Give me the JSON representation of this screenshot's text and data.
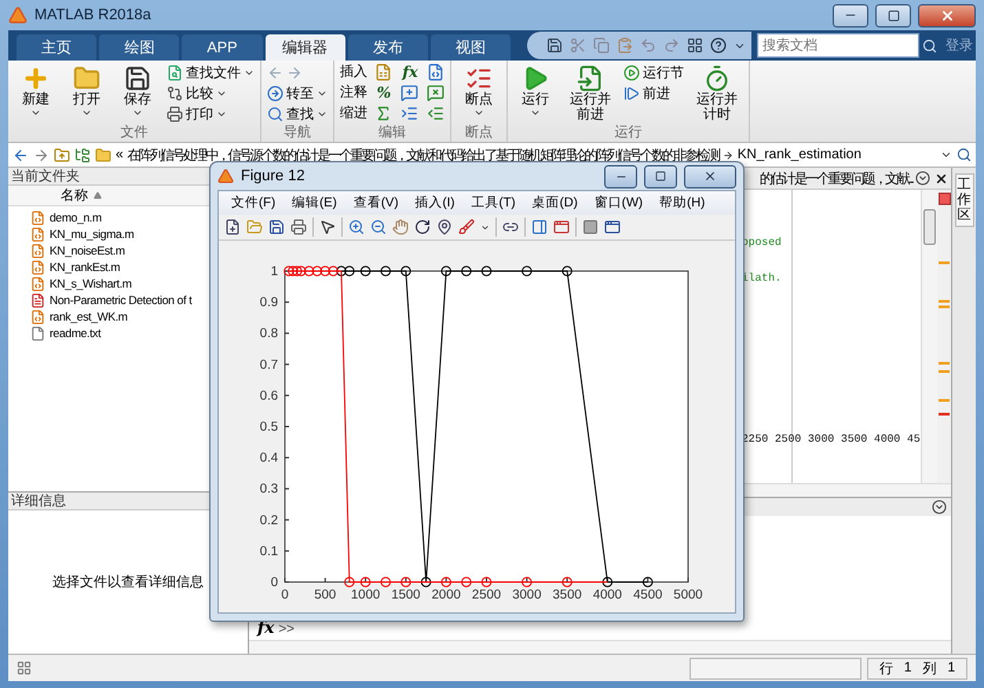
{
  "window": {
    "title": "MATLAB R2018a"
  },
  "ribbon_tabs": [
    {
      "label": "主页",
      "selected": false
    },
    {
      "label": "绘图",
      "selected": false
    },
    {
      "label": "APP",
      "selected": false
    },
    {
      "label": "编辑器",
      "selected": true
    },
    {
      "label": "发布",
      "selected": false
    },
    {
      "label": "视图",
      "selected": false
    }
  ],
  "search": {
    "placeholder": "搜索文档"
  },
  "login": "登录",
  "ribbon_groups": [
    {
      "label": "文件",
      "columns": [
        [
          {
            "label": "新建",
            "kind": "large"
          }
        ],
        [
          {
            "label": "打开",
            "kind": "large"
          }
        ],
        [
          {
            "label": "保存",
            "kind": "large"
          }
        ],
        [
          {
            "label": "查找文件",
            "kind": "small"
          },
          {
            "label": "比较",
            "kind": "small"
          },
          {
            "label": "打印",
            "kind": "small"
          }
        ]
      ]
    },
    {
      "label": "导航",
      "columns": [
        [
          {
            "kind": "arrows"
          },
          {
            "label": "转至",
            "kind": "small"
          },
          {
            "label": "查找",
            "kind": "small"
          }
        ]
      ]
    },
    {
      "label": "编辑",
      "columns": [
        [
          {
            "label": "插入",
            "kind": "text"
          },
          {
            "label": "注释",
            "kind": "text"
          },
          {
            "label": "缩进",
            "kind": "text"
          }
        ],
        [
          {
            "kind": "icon"
          },
          {
            "label": "%",
            "kind": "glyph"
          },
          {
            "kind": "icon"
          }
        ],
        [
          {
            "label": "fx",
            "kind": "glyph"
          },
          {
            "kind": "icon"
          },
          {
            "kind": "icon"
          }
        ],
        [
          {
            "kind": "icon"
          },
          {
            "kind": "icon"
          },
          {
            "kind": "icon"
          }
        ]
      ]
    },
    {
      "label": "断点",
      "columns": [
        [
          {
            "label": "断点",
            "kind": "large"
          }
        ]
      ]
    },
    {
      "label": "运行",
      "columns": [
        [
          {
            "label": "运行",
            "kind": "large"
          }
        ],
        [
          {
            "label": "运行并前进",
            "kind": "large"
          }
        ],
        [
          {
            "label": "运行节",
            "kind": "small"
          },
          {
            "label": "前进",
            "kind": "small"
          }
        ],
        [
          {
            "label": "运行并计时",
            "kind": "large"
          }
        ]
      ]
    }
  ],
  "address": {
    "overflow": "«",
    "crumbs": [
      "在阵列信号处理中，信号源个数的估计是一个重要问题，文献和代码给出了基于随机矩阵理论的阵列信号个数的非参检测",
      "KN_rank_estimation"
    ]
  },
  "current_folder": {
    "title": "当前文件夹",
    "column": "名称",
    "files": [
      {
        "name": "demo_n.m",
        "kind": "m"
      },
      {
        "name": "KN_mu_sigma.m",
        "kind": "m"
      },
      {
        "name": "KN_noiseEst.m",
        "kind": "m"
      },
      {
        "name": "KN_rankEst.m",
        "kind": "m"
      },
      {
        "name": "KN_s_Wishart.m",
        "kind": "m"
      },
      {
        "name": "Non-Parametric Detection of t",
        "kind": "pdf"
      },
      {
        "name": "rank_est_WK.m",
        "kind": "m"
      },
      {
        "name": "readme.txt",
        "kind": "txt"
      }
    ]
  },
  "details": {
    "title": "详细信息",
    "message": "选择文件以查看详细信息"
  },
  "editor": {
    "tab_title": "的估计是一个重要问题，文献...",
    "lines": [
      {
        "kind": "blank"
      },
      {
        "kind": "blank"
      },
      {
        "text": "oposed",
        "kind": "comment"
      },
      {
        "kind": "blank"
      },
      {
        "text": "ilath.",
        "kind": "comment"
      },
      {
        "kind": "blank"
      },
      {
        "kind": "blank"
      },
      {
        "kind": "blank"
      },
      {
        "kind": "blank"
      },
      {
        "kind": "blank"
      },
      {
        "kind": "blank"
      },
      {
        "kind": "blank"
      },
      {
        "kind": "blank"
      },
      {
        "text": "2250 2500 3000 3500 4000 45",
        "kind": "code"
      }
    ]
  },
  "command_window": {
    "fx": "fx",
    "prompt": ">>"
  },
  "workspace": {
    "label": "工作区"
  },
  "status_bar": {
    "row_label": "行",
    "row": "1",
    "col_label": "列",
    "col": "1"
  },
  "figure": {
    "title": "Figure 12",
    "menu": [
      "文件(F)",
      "编辑(E)",
      "查看(V)",
      "插入(I)",
      "工具(T)",
      "桌面(D)",
      "窗口(W)",
      "帮助(H)"
    ],
    "chart_data": {
      "type": "line",
      "x": [
        50,
        100,
        150,
        200,
        300,
        400,
        500,
        600,
        700,
        800,
        1000,
        1250,
        1500,
        1750,
        2000,
        2250,
        2500,
        3000,
        3500,
        4000,
        4500
      ],
      "series": [
        {
          "color": "#000000",
          "marker": "o",
          "values": [
            null,
            null,
            null,
            null,
            null,
            null,
            null,
            null,
            1,
            1,
            1,
            1,
            1,
            0,
            1,
            1,
            1,
            1,
            1,
            0,
            0
          ]
        },
        {
          "color": "#ff0000",
          "marker": "o",
          "values": [
            1,
            1,
            1,
            1,
            1,
            1,
            1,
            1,
            1,
            0,
            0,
            0,
            0,
            0,
            0,
            0,
            0,
            0,
            0,
            0,
            null
          ]
        }
      ],
      "xlim": [
        0,
        5000
      ],
      "ylim": [
        0,
        1
      ],
      "xticks": [
        0,
        500,
        1000,
        1500,
        2000,
        2500,
        3000,
        3500,
        4000,
        4500,
        5000
      ],
      "yticks": [
        0,
        0.1,
        0.2,
        0.3,
        0.4,
        0.5,
        0.6,
        0.7,
        0.8,
        0.9,
        1
      ]
    }
  }
}
